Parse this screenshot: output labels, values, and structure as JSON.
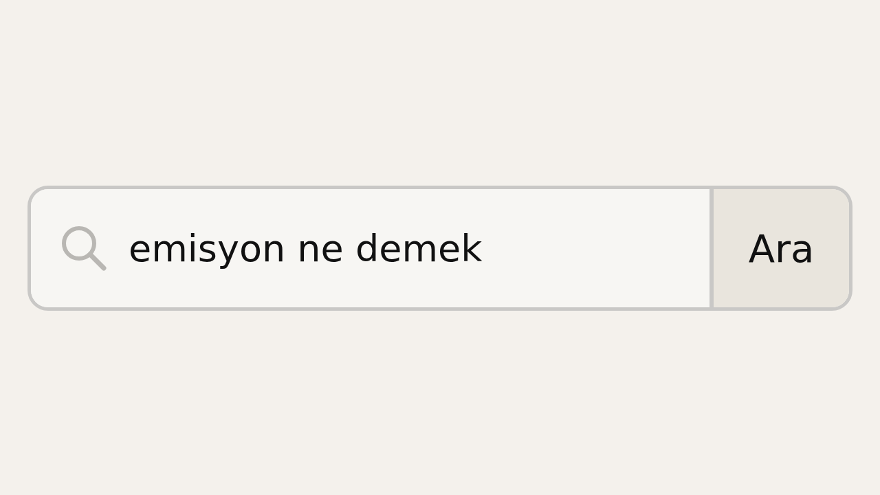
{
  "search": {
    "value": "emisyon ne demek"
  },
  "button": {
    "label": "Ara"
  }
}
